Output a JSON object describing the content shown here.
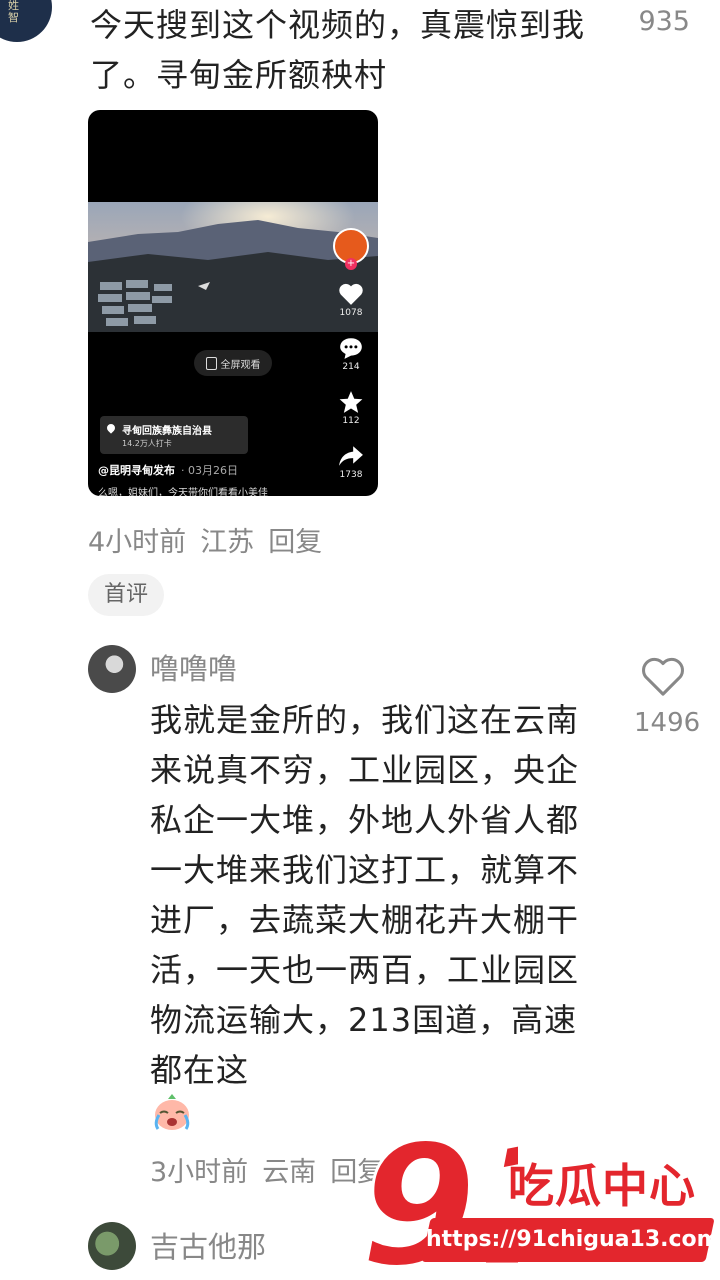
{
  "comment1": {
    "text": "今天搜到这个视频的，真震惊到我了。寻甸金所额秧村",
    "like_count": "935",
    "time": "4小时前",
    "location": "江苏",
    "reply_label": "回复",
    "tag": "首评"
  },
  "video": {
    "fullscreen_label": "全屏观看",
    "likes": "1078",
    "comments": "214",
    "favorites": "112",
    "shares": "1738",
    "location_name": "寻甸回族彝族自治县",
    "location_sub": "14.2万人打卡",
    "author": "@昆明寻甸发布",
    "date": "· 03月26日",
    "caption": "么嗯，姐妹们，今天带你们看看小美佳"
  },
  "comment2": {
    "username": "噜噜噜",
    "text": "我就是金所的，我们这在云南来说真不穷，工业园区，央企私企一大堆，外地人外省人都一大堆来我们这打工，就算不进厂，去蔬菜大棚花卉大棚干活，一天也一两百，工业园区物流运输大，213国道，高速都在这",
    "like_count": "1496",
    "time": "3小时前",
    "location": "云南",
    "reply_label": "回复"
  },
  "comment3": {
    "username": "吉古他那"
  },
  "watermark": {
    "logo_number": "91",
    "title": "吃瓜中心",
    "url": "https://91chigua13.com",
    "color": "#e3262d"
  }
}
